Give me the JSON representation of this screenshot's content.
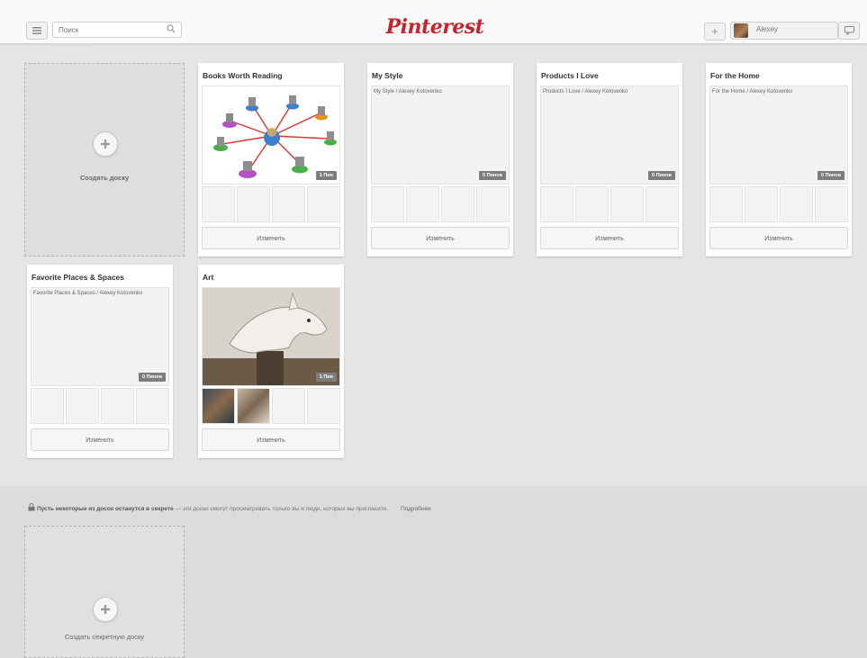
{
  "header": {
    "search_placeholder": "Поиск",
    "logo": "Pinterest",
    "user_name": "Alexey"
  },
  "create_board": {
    "label": "Создать доску"
  },
  "boards": [
    {
      "title": "Books Worth Reading",
      "caption": "",
      "pin_count": "1 Пин",
      "edit_label": "Изменить"
    },
    {
      "title": "My Style",
      "caption": "My Style / Alexey Kotovenko",
      "pin_count": "0 Пинов",
      "edit_label": "Изменить"
    },
    {
      "title": "Products I Love",
      "caption": "Products I Love / Alexey Kotovenko",
      "pin_count": "0 Пинов",
      "edit_label": "Изменить"
    },
    {
      "title": "For the Home",
      "caption": "For the Home / Alexey Kotovenko",
      "pin_count": "0 Пинов",
      "edit_label": "Изменить"
    },
    {
      "title": "Favorite Places & Spaces",
      "caption": "Favorite Places & Spaces / Alexey Kotovenko",
      "pin_count": "0 Пинов",
      "edit_label": "Изменить"
    },
    {
      "title": "Art",
      "caption": "",
      "pin_count": "1 Пин",
      "edit_label": "Изменить"
    }
  ],
  "secret": {
    "note_bold": "Пусть некоторые из досок останутся в секрете",
    "note_rest": " — эти доски смогут просматривать только вы и люди, которых вы пригласите.",
    "more_link": "Подробнее",
    "create_label": "Создать секретную доску"
  },
  "colors": {
    "brand": "#c8232c",
    "background": "#e6e5e5"
  }
}
